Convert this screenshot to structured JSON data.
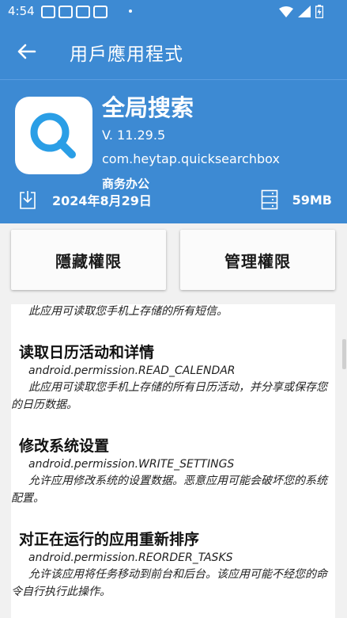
{
  "status_bar": {
    "time": "4:54"
  },
  "app_bar": {
    "title": "用戶應用程式"
  },
  "app": {
    "name": "全局搜索",
    "version": "V. 11.29.5",
    "package": "com.heytap.quicksearchbox",
    "category": "商务办公",
    "date": "2024年8月29日",
    "size": "59MB",
    "icon": "magnifier-icon",
    "accent_color": "#3d8ad3"
  },
  "actions": {
    "hidden_permissions": "隱藏權限",
    "manage_permissions": "管理權限"
  },
  "permissions": {
    "top_desc": "此应用可读取您手机上存储的所有短信。",
    "items": [
      {
        "title": "读取日历活动和详情",
        "id": "android.permission.READ_CALENDAR",
        "desc": "此应用可读取您手机上存储的所有日历活动，并分享或保存您的日历数据。"
      },
      {
        "title": "修改系统设置",
        "id": "android.permission.WRITE_SETTINGS",
        "desc": "允许应用修改系统的设置数据。恶意应用可能会破坏您的系统配置。"
      },
      {
        "title": "对正在运行的应用重新排序",
        "id": "android.permission.REORDER_TASKS",
        "desc": "允许该应用将任务移动到前台和后台。该应用可能不经您的命令自行执行此操作。"
      }
    ]
  }
}
